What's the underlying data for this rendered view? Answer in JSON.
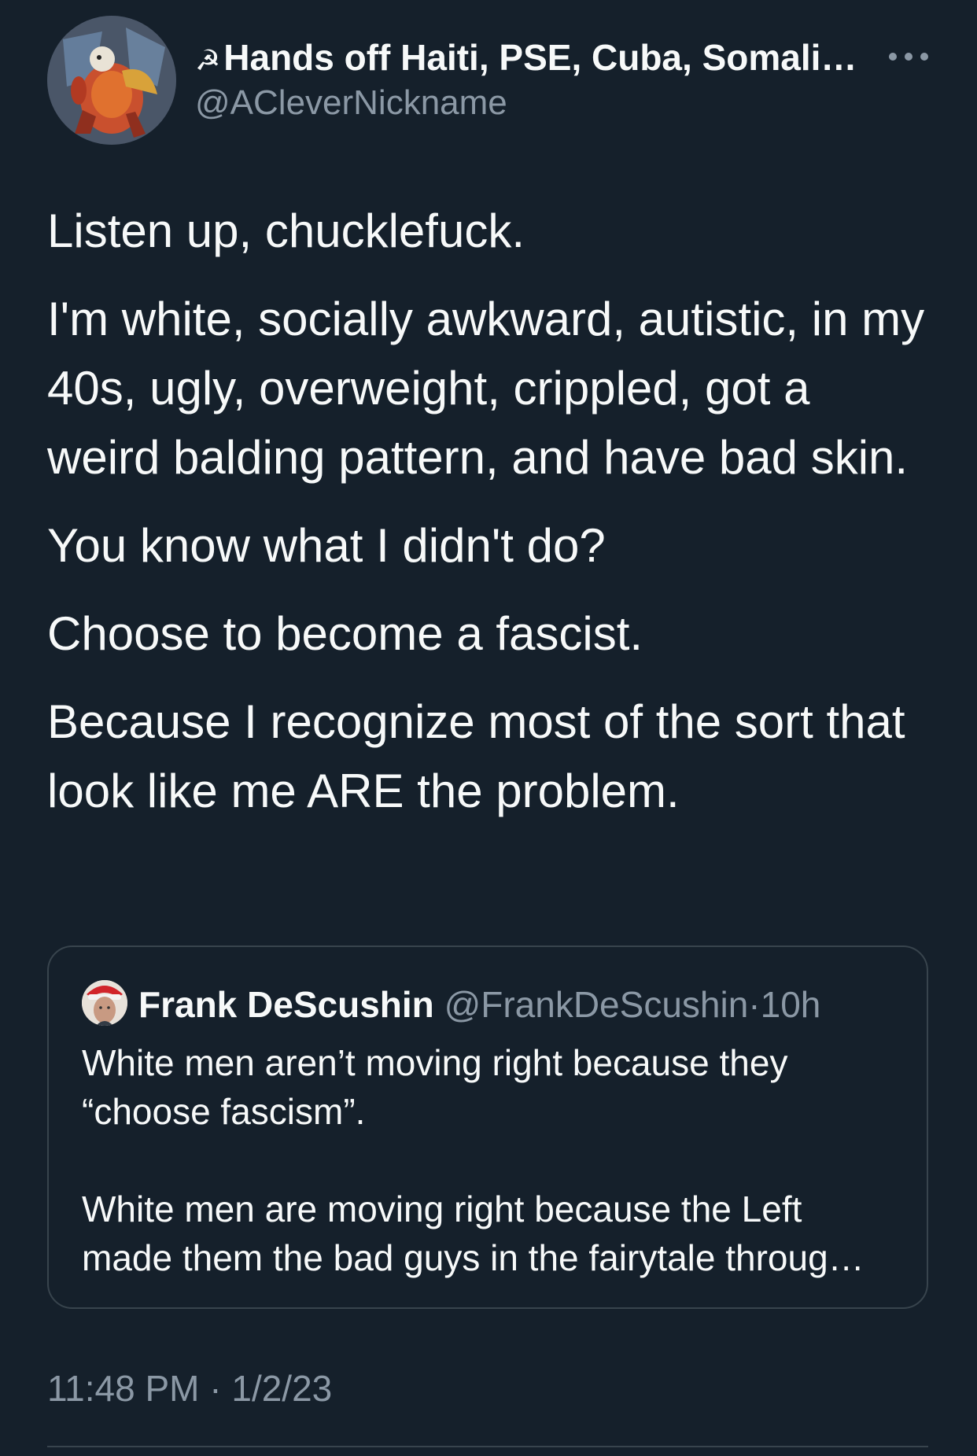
{
  "author": {
    "display_name_emoji": "☭",
    "display_name": "Hands off Haiti, PSE, Cuba, Somali…",
    "handle": "@ACleverNickname"
  },
  "more_icon": "more-horizontal-icon",
  "tweet": {
    "paragraphs": [
      "Listen up, chucklefuck.",
      "I'm white, socially awkward, autistic, in my 40s, ugly, overweight, crippled, got a weird balding pattern, and have bad skin.",
      "You know what I didn't do?",
      "Choose to become a fascist.",
      "Because I recognize most of the sort that look like me ARE the problem."
    ]
  },
  "quoted_tweet": {
    "display_name": "Frank DeScushin",
    "handle": "@FrankDeScushin",
    "separator": "·",
    "time": "10h",
    "paragraphs": [
      "White men aren’t moving right because they “choose fascism”.",
      "White men are moving right because the Left made them the bad guys in the fairytale throug…"
    ]
  },
  "timestamp": "11:48 PM · 1/2/23",
  "colors": {
    "background": "#15202b",
    "primary_text": "#f7f9f9",
    "secondary_text": "#8b98a5",
    "border": "#38444d"
  }
}
